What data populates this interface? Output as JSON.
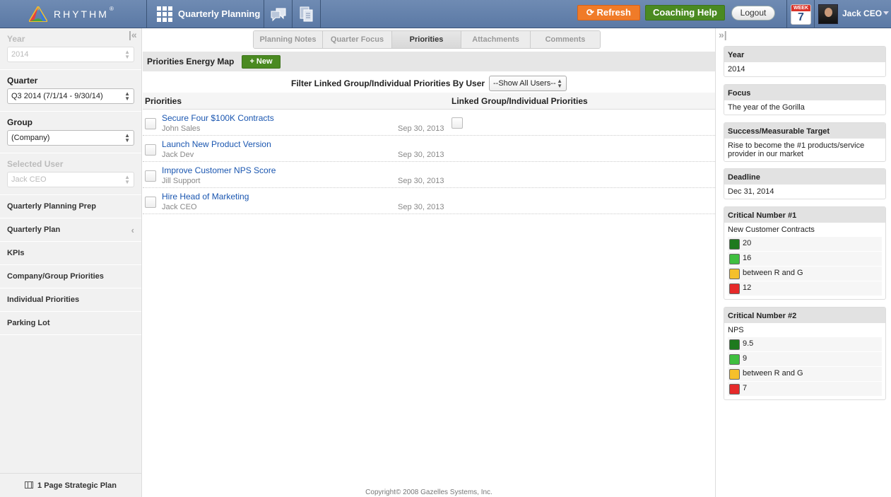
{
  "topbar": {
    "brand": "RHYTHM",
    "brand_mark": "®",
    "module_title": "Quarterly Planning",
    "refresh_label": "Refresh",
    "coaching_label": "Coaching Help",
    "logout_label": "Logout",
    "week_label": "WEEK",
    "week_number": "7",
    "user_name": "Jack CEO",
    "colors": {
      "refresh": "#f07b28",
      "coaching": "#4a8a21",
      "bar": "#5b79a5"
    }
  },
  "sidebar": {
    "year_label": "Year",
    "year_value": "2014",
    "quarter_label": "Quarter",
    "quarter_value": "Q3 2014 (7/1/14 - 9/30/14)",
    "group_label": "Group",
    "group_value": "(Company)",
    "selected_user_label": "Selected User",
    "selected_user_value": "Jack CEO",
    "nav": [
      {
        "label": "Quarterly Planning Prep"
      },
      {
        "label": "Quarterly Plan"
      },
      {
        "label": "KPIs"
      },
      {
        "label": "Company/Group Priorities"
      },
      {
        "label": "Individual Priorities"
      },
      {
        "label": "Parking Lot"
      }
    ],
    "footer_link": "1 Page Strategic Plan"
  },
  "main": {
    "tabs": [
      {
        "label": "Planning Notes"
      },
      {
        "label": "Quarter Focus"
      },
      {
        "label": "Priorities"
      },
      {
        "label": "Attachments"
      },
      {
        "label": "Comments"
      }
    ],
    "active_tab": "Priorities",
    "energy_title": "Priorities Energy Map",
    "new_label": "+ New",
    "filter_label": "Filter Linked Group/Individual Priorities By User",
    "filter_value": "--Show All Users--",
    "col_priorities": "Priorities",
    "col_linked": "Linked Group/Individual Priorities",
    "priorities": [
      {
        "title": "Secure Four $100K Contracts",
        "owner": "John Sales",
        "date": "Sep 30, 2013"
      },
      {
        "title": "Launch New Product Version",
        "owner": "Jack Dev",
        "date": "Sep 30, 2013"
      },
      {
        "title": "Improve Customer NPS Score",
        "owner": "Jill Support",
        "date": "Sep 30, 2013"
      },
      {
        "title": "Hire Head of Marketing",
        "owner": "Jack CEO",
        "date": "Sep 30, 2013"
      }
    ],
    "copyright": "Copyright© 2008 Gazelles Systems, Inc."
  },
  "rightbar": {
    "year_head": "Year",
    "year_value": "2014",
    "focus_head": "Focus",
    "focus_value": "The year of the Gorilla",
    "target_head": "Success/Measurable Target",
    "target_value": "Rise to become the #1 products/service provider in our market",
    "deadline_head": "Deadline",
    "deadline_value": "Dec 31, 2014",
    "crit1_head": "Critical Number #1",
    "crit1_name": "New Customer Contracts",
    "crit1_levels": [
      {
        "value": "20",
        "color": "#1e7a1e"
      },
      {
        "value": "16",
        "color": "#3fbf3f"
      },
      {
        "value": "between R and G",
        "color": "#f5c02b"
      },
      {
        "value": "12",
        "color": "#e62a2a"
      }
    ],
    "crit2_head": "Critical Number #2",
    "crit2_name": "NPS",
    "crit2_levels": [
      {
        "value": "9.5",
        "color": "#1e7a1e"
      },
      {
        "value": "9",
        "color": "#3fbf3f"
      },
      {
        "value": "between R and G",
        "color": "#f5c02b"
      },
      {
        "value": "7",
        "color": "#e62a2a"
      }
    ]
  }
}
